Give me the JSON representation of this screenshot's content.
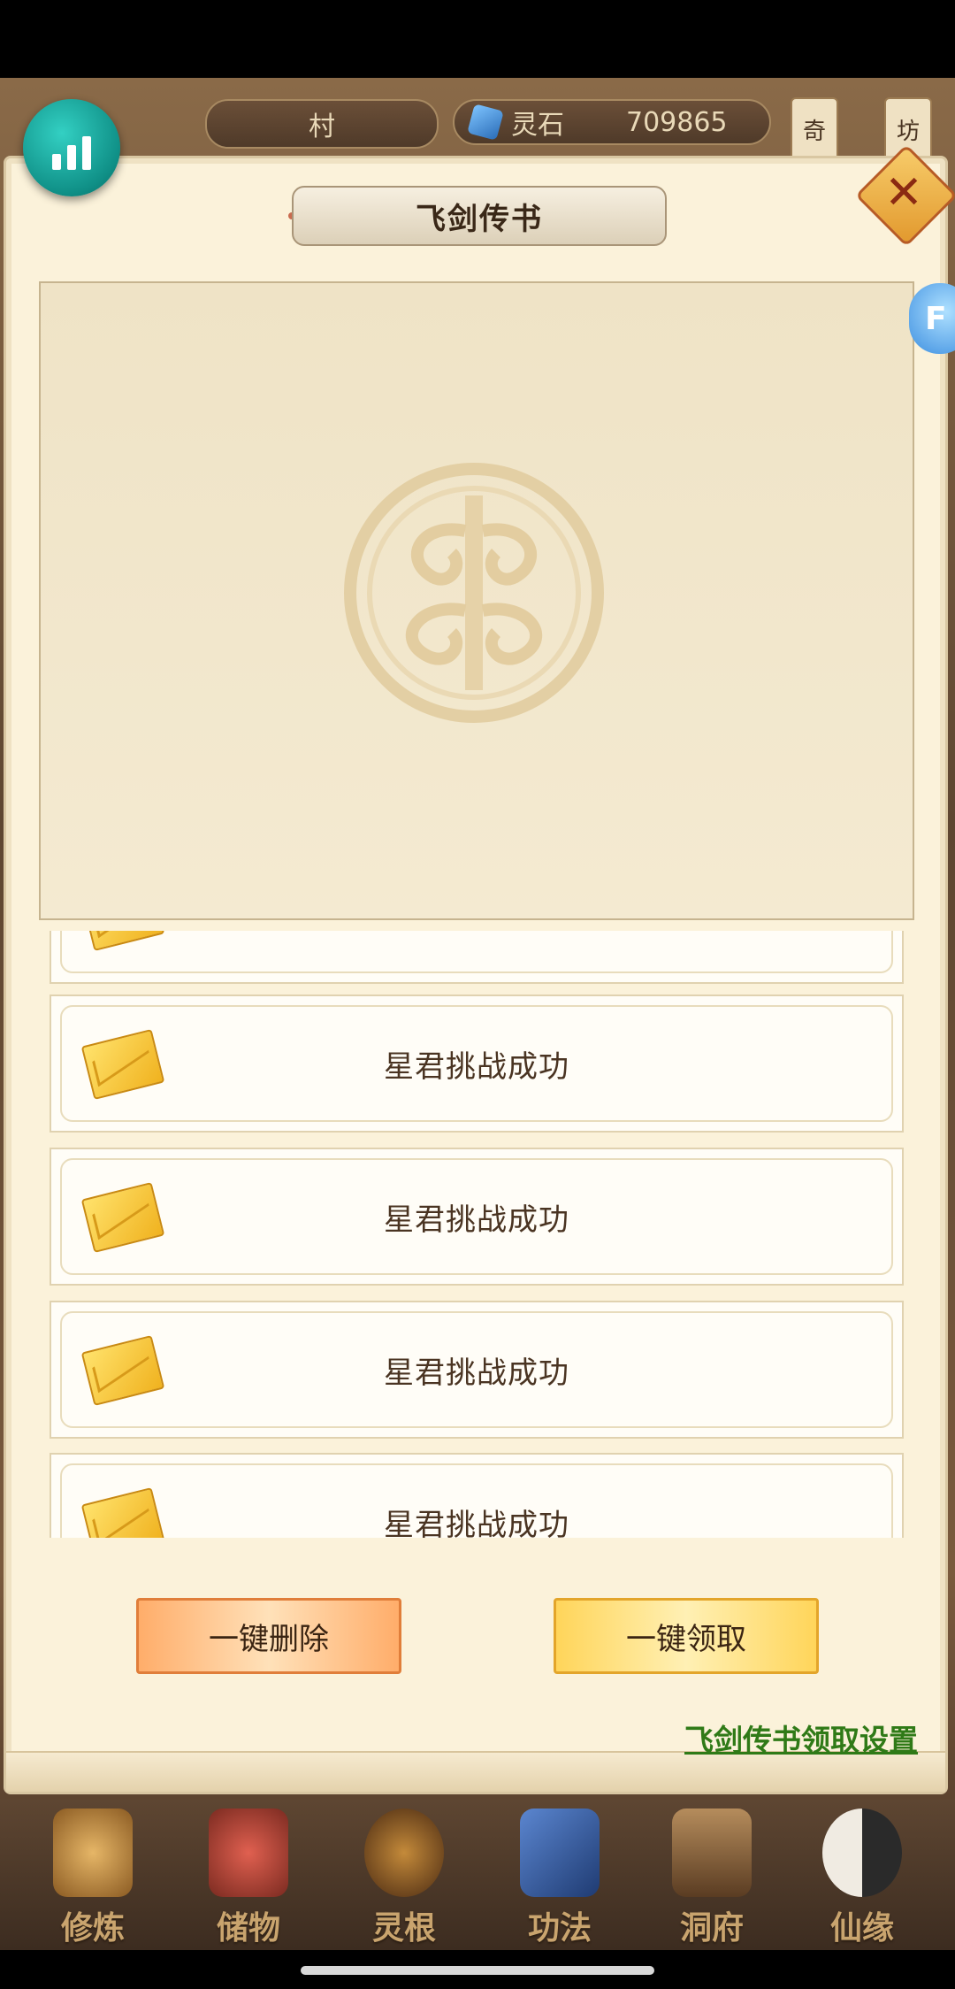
{
  "topbar": {
    "village_label": "村",
    "stone_label": "灵石",
    "stone_value": "709865",
    "side_tag_1": "奇",
    "side_tag_2": "坊"
  },
  "panel": {
    "title": "飞剑传书",
    "close_icon": "close-icon",
    "mascot_text": "F"
  },
  "mail_list": {
    "items": [
      {
        "title": "星君挑战成功"
      },
      {
        "title": "星君挑战成功"
      },
      {
        "title": "星君挑战成功"
      },
      {
        "title": "星君挑战成功"
      }
    ]
  },
  "actions": {
    "delete_all": "一键删除",
    "claim_all": "一键领取",
    "settings_link": "飞剑传书领取设置"
  },
  "bottom_nav": {
    "items": [
      {
        "label": "修炼",
        "color": "#c99a52"
      },
      {
        "label": "储物",
        "color": "#c04a3a"
      },
      {
        "label": "灵根",
        "color": "#8a5a2a"
      },
      {
        "label": "功法",
        "color": "#3a5ea0"
      },
      {
        "label": "洞府",
        "color": "#8a6a4a"
      },
      {
        "label": "仙缘",
        "color": "#d9cfc2"
      }
    ]
  },
  "colors": {
    "panel_bg": "#fbf2da",
    "link_green": "#2f7a17",
    "accent_teal": "#16a398"
  }
}
